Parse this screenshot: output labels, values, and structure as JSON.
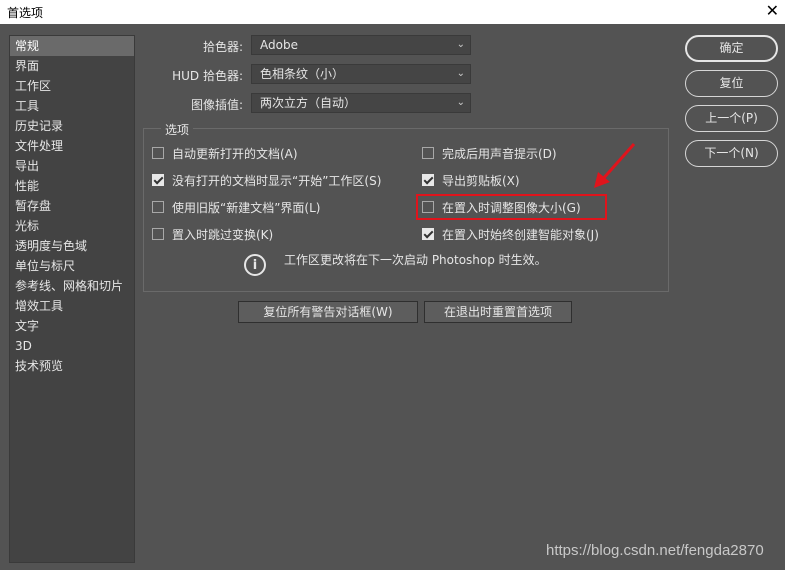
{
  "window": {
    "title": "首选项",
    "close": "✕"
  },
  "sidebar": {
    "items": [
      {
        "label": "常规",
        "active": true
      },
      {
        "label": "界面"
      },
      {
        "label": "工作区"
      },
      {
        "label": "工具"
      },
      {
        "label": "历史记录"
      },
      {
        "label": "文件处理"
      },
      {
        "label": "导出"
      },
      {
        "label": "性能"
      },
      {
        "label": "暂存盘"
      },
      {
        "label": "光标"
      },
      {
        "label": "透明度与色域"
      },
      {
        "label": "单位与标尺"
      },
      {
        "label": "参考线、网格和切片"
      },
      {
        "label": "增效工具"
      },
      {
        "label": "文字"
      },
      {
        "label": "3D"
      },
      {
        "label": "技术预览"
      }
    ]
  },
  "fields": {
    "color_picker": {
      "label": "拾色器:",
      "value": "Adobe"
    },
    "hud_color_picker": {
      "label": "HUD 拾色器:",
      "value": "色相条纹（小）"
    },
    "image_interpolation": {
      "label": "图像插值:",
      "value": "两次立方（自动）"
    }
  },
  "options": {
    "title": "选项",
    "left": [
      {
        "label": "自动更新打开的文档(A)",
        "checked": false
      },
      {
        "label": "没有打开的文档时显示“开始”工作区(S)",
        "checked": true
      },
      {
        "label": "使用旧版“新建文档”界面(L)",
        "checked": false
      },
      {
        "label": "置入时跳过变换(K)",
        "checked": false
      }
    ],
    "right": [
      {
        "label": "完成后用声音提示(D)",
        "checked": false
      },
      {
        "label": "导出剪贴板(X)",
        "checked": true
      },
      {
        "label": "在置入时调整图像大小(G)",
        "checked": false
      },
      {
        "label": "在置入时始终创建智能对象(J)",
        "checked": true
      }
    ],
    "info_icon": "i",
    "info_text": "工作区更改将在下一次启动 Photoshop 时生效。"
  },
  "buttons": {
    "reset_warnings": "复位所有警告对话框(W)",
    "reset_on_quit": "在退出时重置首选项",
    "ok": "确定",
    "reset": "复位",
    "prev": "上一个(P)",
    "next": "下一个(N)"
  },
  "annotation_color": "#e0141c",
  "watermark": "https://blog.csdn.net/fengda2870"
}
